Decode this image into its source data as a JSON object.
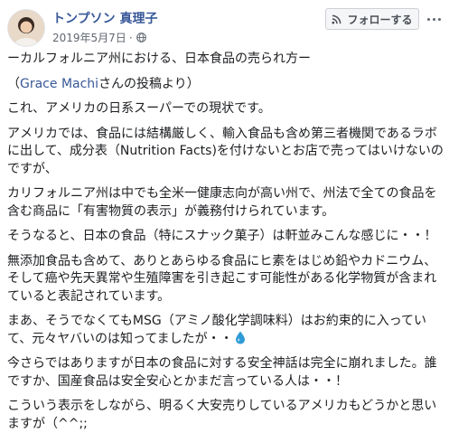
{
  "author": {
    "name": "トンプソン 真理子"
  },
  "meta": {
    "date": "2019年5月7日",
    "separator": "·",
    "privacy_icon": "globe-icon"
  },
  "actions": {
    "follow_label": "フォローする",
    "follow_icon": "rss-icon",
    "more_icon": "more-options-icon"
  },
  "post": {
    "p1": "ーカルフォルニア州における、日本食品の売られ方ー",
    "p2_prefix": "（",
    "p2_mention": "Grace Machi",
    "p2_suffix": "さんの投稿より）",
    "p3": "これ、アメリカの日系スーパーでの現状です。",
    "p4": "アメリカでは、食品には結構厳しく、輸入食品も含め第三者機関であるラボに出して、成分表（Nutrition Facts)を付けないとお店で売ってはいけないのですが、",
    "p5": "カリフォルニア州は中でも全米一健康志向が高い州で、州法で全ての食品を含む商品に「有害物質の表示」が義務付けられています。",
    "p6": "そうなると、日本の食品（特にスナック菓子）は軒並みこんな感じに・・！",
    "p7": "無添加食品も含めて、ありとあらゆる食品にヒ素をはじめ鉛やカドニウム、そして癌や先天異常や生殖障害を引き起こす可能性がある化学物質が含まれていると表記されています。",
    "p8": "まあ、そうでなくてもMSG（アミノ酸化学調味料）はお約束的に入っていて、元々ヤバいのは知ってましたが・・",
    "p8_icon": "droplet-icon",
    "p9": "今さらではありますが日本の食品に対する安全神話は完全に崩れました。誰ですか、国産食品は安全安心とかまだ言っている人は・・！",
    "p10": "こういう表示をしながら、明るく大安売りしているアメリカもどうかと思いますが（^^;;"
  },
  "colors": {
    "link": "#385898",
    "text": "#1c1e21",
    "meta": "#606770",
    "droplet": "#2f9bd6"
  }
}
